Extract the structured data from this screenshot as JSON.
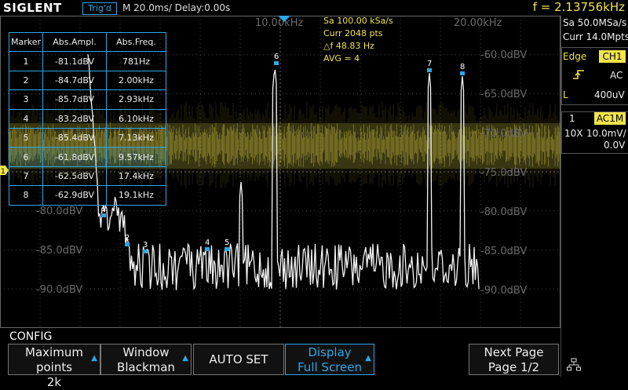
{
  "header": {
    "brand": "SIGLENT",
    "trigger_status": "Trig'd",
    "timebase": "M 20.0ms/ Delay:0.00s",
    "cursor_freq": "f = 2.13756kHz"
  },
  "fft_info": {
    "sample_rate": "Sa 100.00 kSa/s",
    "points": "Curr 2048 pts",
    "resolution": "△f 48.83 Hz",
    "averaging": "AVG = 4"
  },
  "axis": {
    "x_labels": [
      "10.00kHz",
      "20.00kHz"
    ],
    "y_labels_right": [
      "-60.0dBV",
      "-65.0dBV",
      "-70.0dBV",
      "-75.0dBV",
      "-80.0dBV",
      "-85.0dBV",
      "-90.0dBV"
    ],
    "y_labels_left": [
      "-80.0dBV",
      "-85.0dBV",
      "-90.0dBV"
    ]
  },
  "marker_table": {
    "headers": [
      "Marker",
      "Abs.Ampl.",
      "Abs.Freq."
    ],
    "rows": [
      [
        "1",
        "-81.1dBV",
        "781Hz"
      ],
      [
        "2",
        "-84.7dBV",
        "2.00kHz"
      ],
      [
        "3",
        "-85.7dBV",
        "2.93kHz"
      ],
      [
        "4",
        "-83.2dBV",
        "6.10kHz"
      ],
      [
        "5",
        "-85.4dBV",
        "7.13kHz"
      ],
      [
        "6",
        "-61.8dBV",
        "9.57kHz"
      ],
      [
        "7",
        "-62.5dBV",
        "17.4kHz"
      ],
      [
        "8",
        "-62.9dBV",
        "19.1kHz"
      ]
    ]
  },
  "trace_markers": [
    "1",
    "2",
    "3",
    "4",
    "5",
    "6",
    "7",
    "8"
  ],
  "channel_marker": "1",
  "right_panel": {
    "sample": "Sa 50.0MSa/s",
    "memory": "Curr 14.0Mpts",
    "trigger_type": "Edge",
    "trigger_source": "CH1",
    "coupling": "AC",
    "level_label": "L",
    "level": "400uV",
    "ch_num": "1",
    "ch_coupling": "AC1M",
    "probe": "10X",
    "vdiv": "10.0mV/",
    "offset": "0.0V"
  },
  "menu": {
    "title": "CONFIG",
    "softkeys": [
      {
        "l1": "Maximum points",
        "l2": "2k"
      },
      {
        "l1": "Window",
        "l2": "Blackman"
      },
      {
        "l1": "AUTO SET",
        "l2": ""
      },
      {
        "l1": "Display",
        "l2": "Full Screen"
      },
      {
        "l1": "",
        "l2": ""
      },
      {
        "l1": "Next Page",
        "l2": "Page 1/2"
      }
    ]
  },
  "colors": {
    "ch1": "#f1e34c",
    "accent": "#2ea7e6",
    "grid": "#555555"
  }
}
